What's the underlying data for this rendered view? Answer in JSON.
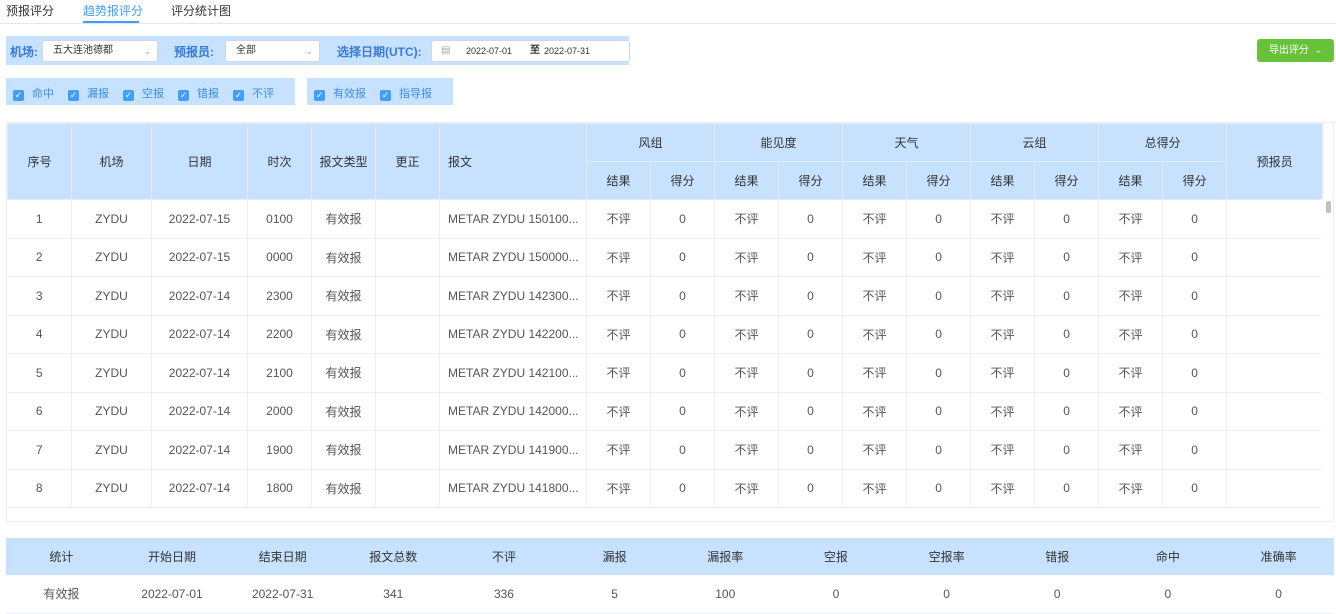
{
  "tabs": [
    "预报评分",
    "趋势报评分",
    "评分统计图"
  ],
  "filters": {
    "airport_label": "机场:",
    "airport_value": "五大连池德都",
    "forecaster_label": "预报员:",
    "forecaster_value": "全部",
    "date_label": "选择日期(UTC):",
    "date_start": "2022-07-01",
    "date_sep": "至",
    "date_end": "2022-07-31"
  },
  "export_label": "导出评分",
  "checkboxes": {
    "group1": [
      "命中",
      "漏报",
      "空报",
      "错报",
      "不评"
    ],
    "group2": [
      "有效报",
      "指导报"
    ]
  },
  "table": {
    "headers": {
      "index": "序号",
      "airport": "机场",
      "date": "日期",
      "time": "时次",
      "type": "报文类型",
      "correction": "更正",
      "report": "报文",
      "forecaster": "预报员",
      "groups": [
        "风组",
        "能见度",
        "天气",
        "云组",
        "总得分"
      ],
      "result": "结果",
      "score": "得分"
    },
    "rows": [
      [
        "1",
        "ZYDU",
        "2022-07-15",
        "0100",
        "有效报",
        "",
        "METAR ZYDU 150100...",
        "不评",
        "0",
        "不评",
        "0",
        "不评",
        "0",
        "不评",
        "0",
        "不评",
        "0",
        ""
      ],
      [
        "2",
        "ZYDU",
        "2022-07-15",
        "0000",
        "有效报",
        "",
        "METAR ZYDU 150000...",
        "不评",
        "0",
        "不评",
        "0",
        "不评",
        "0",
        "不评",
        "0",
        "不评",
        "0",
        ""
      ],
      [
        "3",
        "ZYDU",
        "2022-07-14",
        "2300",
        "有效报",
        "",
        "METAR ZYDU 142300...",
        "不评",
        "0",
        "不评",
        "0",
        "不评",
        "0",
        "不评",
        "0",
        "不评",
        "0",
        ""
      ],
      [
        "4",
        "ZYDU",
        "2022-07-14",
        "2200",
        "有效报",
        "",
        "METAR ZYDU 142200...",
        "不评",
        "0",
        "不评",
        "0",
        "不评",
        "0",
        "不评",
        "0",
        "不评",
        "0",
        ""
      ],
      [
        "5",
        "ZYDU",
        "2022-07-14",
        "2100",
        "有效报",
        "",
        "METAR ZYDU 142100...",
        "不评",
        "0",
        "不评",
        "0",
        "不评",
        "0",
        "不评",
        "0",
        "不评",
        "0",
        ""
      ],
      [
        "6",
        "ZYDU",
        "2022-07-14",
        "2000",
        "有效报",
        "",
        "METAR ZYDU 142000...",
        "不评",
        "0",
        "不评",
        "0",
        "不评",
        "0",
        "不评",
        "0",
        "不评",
        "0",
        ""
      ],
      [
        "7",
        "ZYDU",
        "2022-07-14",
        "1900",
        "有效报",
        "",
        "METAR ZYDU 141900...",
        "不评",
        "0",
        "不评",
        "0",
        "不评",
        "0",
        "不评",
        "0",
        "不评",
        "0",
        ""
      ],
      [
        "8",
        "ZYDU",
        "2022-07-14",
        "1800",
        "有效报",
        "",
        "METAR ZYDU 141800...",
        "不评",
        "0",
        "不评",
        "0",
        "不评",
        "0",
        "不评",
        "0",
        "不评",
        "0",
        ""
      ]
    ]
  },
  "stats": {
    "headers": [
      "统计",
      "开始日期",
      "结束日期",
      "报文总数",
      "不评",
      "漏报",
      "漏报率",
      "空报",
      "空报率",
      "错报",
      "命中",
      "准确率"
    ],
    "rows": [
      [
        "有效报",
        "2022-07-01",
        "2022-07-31",
        "341",
        "336",
        "5",
        "100",
        "0",
        "0",
        "0",
        "0",
        "0"
      ]
    ]
  }
}
